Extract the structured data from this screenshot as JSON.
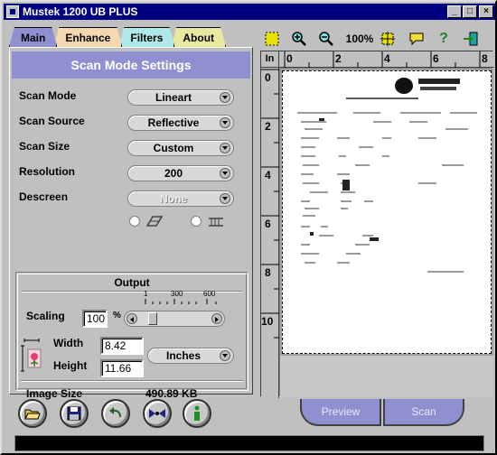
{
  "window": {
    "title": "Mustek 1200 UB PLUS"
  },
  "title_buttons": [
    "_",
    "□",
    "×"
  ],
  "tabs": [
    {
      "label": "Main"
    },
    {
      "label": "Enhance"
    },
    {
      "label": "Filters"
    },
    {
      "label": "About"
    }
  ],
  "main": {
    "header": "Scan Mode Settings",
    "scan_mode": {
      "label": "Scan Mode",
      "value": "Lineart"
    },
    "scan_source": {
      "label": "Scan Source",
      "value": "Reflective"
    },
    "scan_size": {
      "label": "Scan Size",
      "value": "Custom"
    },
    "resolution": {
      "label": "Resolution",
      "value": "200"
    },
    "descreen": {
      "label": "Descreen",
      "value": "None"
    }
  },
  "output": {
    "title": "Output",
    "scaling_label": "Scaling",
    "scaling_value": "100",
    "scaling_unit": "%",
    "ticks": [
      "1",
      "300",
      "600"
    ],
    "width_label": "Width",
    "width_value": "8.42",
    "height_label": "Height",
    "height_value": "11.66",
    "units": "Inches",
    "image_size_label": "Image Size",
    "image_size_value": "490.89 KB"
  },
  "toolbar": {
    "zoom": "100%"
  },
  "ruler": {
    "unit": "In",
    "h_marks": [
      "0",
      "2",
      "4",
      "6",
      "8"
    ],
    "v_marks": [
      "0",
      "2",
      "4",
      "6",
      "8",
      "10"
    ]
  },
  "actions": {
    "preview": "Preview",
    "scan": "Scan"
  },
  "colors": {
    "titlebar": "#000080",
    "accent": "#8f90d0"
  }
}
